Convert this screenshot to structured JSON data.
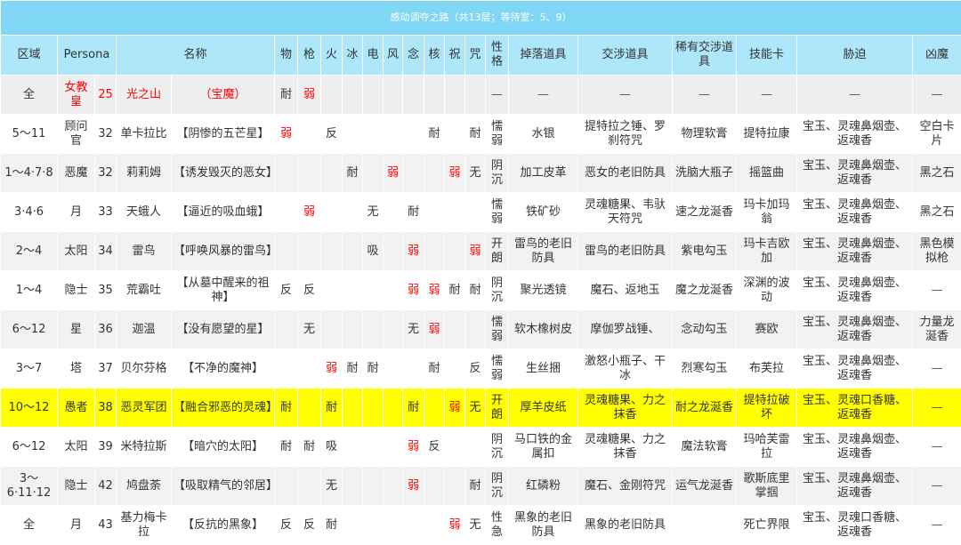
{
  "table": {
    "title": "感动调夺之路（共13层；等待室：5、9）",
    "headers": [
      "区域",
      "Persona",
      "名称",
      "物",
      "枪",
      "火",
      "冰",
      "电",
      "风",
      "念",
      "核",
      "祝",
      "咒",
      "性格",
      "掉落道具",
      "交涉道具",
      "稀有交涉道具",
      "技能卡",
      "胁迫",
      "凶魔"
    ],
    "rows": [
      [
        "全",
        "女教皇",
        "25",
        "光之山",
        "（宝魔）",
        "耐",
        "弱",
        "",
        "",
        "",
        "",
        "",
        "",
        "",
        "",
        "—",
        "—",
        "—",
        "—",
        "—",
        "—",
        "—"
      ],
      [
        "5～11",
        "顾问官",
        "32",
        "单卡拉比",
        "【阴惨的五芒星】",
        "弱",
        "",
        "反",
        "",
        "",
        "",
        "",
        "耐",
        "",
        "耐",
        "懦弱",
        "水银",
        "提特拉之锤、罗刹符咒",
        "物理软膏",
        "提特拉康",
        "宝玉、灵魂鼻烟壶、返魂香",
        "空白卡片"
      ],
      [
        "1～4·7·8",
        "恶魔",
        "32",
        "莉莉姆",
        "【诱发毁灭的恶女】",
        "",
        "",
        "",
        "耐",
        "",
        "弱",
        "",
        "",
        "弱",
        "无",
        "阴沉",
        "加工皮革",
        "恶女的老旧防具",
        "洗脑大瓶子",
        "摇篮曲",
        "宝玉、灵魂鼻烟壶、返魂香",
        "黑之石"
      ],
      [
        "3·4·6",
        "月",
        "33",
        "天蛾人",
        "【逼近的吸血蛾】",
        "",
        "弱",
        "",
        "",
        "无",
        "",
        "耐",
        "",
        "",
        "",
        "懦弱",
        "铁矿砂",
        "灵魂糖果、韦驮天符咒",
        "速之龙涎香",
        "玛卡加玛翁",
        "宝玉、灵魂鼻烟壶、返魂香",
        "黑之石"
      ],
      [
        "2～4",
        "太阳",
        "34",
        "雷鸟",
        "【呼唤风暴的雷鸟】",
        "",
        "",
        "",
        "",
        "吸",
        "",
        "弱",
        "",
        "",
        "弱",
        "开朗",
        "雷鸟的老旧防具",
        "雷鸟的老旧防具",
        "紫电勾玉",
        "玛卡吉欧加",
        "宝玉、灵魂鼻烟壶、返魂香",
        "黑色模拟枪"
      ],
      [
        "1～4",
        "隐士",
        "35",
        "荒霸吐",
        "【从墓中醒来的祖神】",
        "反",
        "反",
        "",
        "",
        "",
        "",
        "弱",
        "弱",
        "耐",
        "耐",
        "阴沉",
        "聚光透镜",
        "魔石、返地玉",
        "魔之龙涎香",
        "深渊的波动",
        "宝玉、灵魂鼻烟壶、返魂香",
        "—"
      ],
      [
        "6～12",
        "星",
        "36",
        "迦温",
        "【没有愿望的星】",
        "",
        "无",
        "",
        "",
        "",
        "",
        "无",
        "弱",
        "",
        "",
        "懦弱",
        "软木橡树皮",
        "摩伽罗战锤、",
        "念动勾玉",
        "赛欧",
        "宝玉、灵魂鼻烟壶、返魂香",
        "力量龙涎香"
      ],
      [
        "3～7",
        "塔",
        "37",
        "贝尔芬格",
        "【不净的魔神】",
        "",
        "",
        "弱",
        "耐",
        "耐",
        "",
        "",
        "耐",
        "",
        "反",
        "懦弱",
        "生丝捆",
        "激怒小瓶子、干冰",
        "烈寒勾玉",
        "布芙拉",
        "宝玉、灵魂鼻烟壶、返魂香",
        "—"
      ],
      [
        "10～12",
        "愚者",
        "38",
        "恶灵军团",
        "【融合邪恶的灵魂】",
        "耐",
        "",
        "耐",
        "",
        "",
        "",
        "耐",
        "",
        "弱",
        "无",
        "开朗",
        "厚羊皮纸",
        "灵魂糖果、力之抹香",
        "耐之龙涎香",
        "提特拉破坏",
        "宝玉、灵魂口香糖、返魂香",
        "—"
      ],
      [
        "6～12",
        "太阳",
        "39",
        "米特拉斯",
        "【暗穴的太阳】",
        "耐",
        "耐",
        "吸",
        "",
        "",
        "",
        "弱",
        "反",
        "",
        "",
        "阴沉",
        "马口铁的金属扣",
        "灵魂糖果、力之抹香",
        "魔法软膏",
        "玛哈芙雷拉",
        "宝玉、灵魂鼻烟壶、返魂香",
        "—"
      ],
      [
        "3～6·11·12",
        "隐士",
        "42",
        "鸠盘荼",
        "【吸取精气的邻居】",
        "",
        "",
        "无",
        "",
        "",
        "",
        "弱",
        "",
        "",
        "耐",
        "阴沉",
        "红磷粉",
        "魔石、金刚符咒",
        "运气龙涎香",
        "歌斯底里掌掴",
        "宝玉、灵魂鼻烟壶、返魂香",
        "—"
      ],
      [
        "全",
        "月",
        "43",
        "基力梅卡拉",
        "【反抗的黑象】",
        "反",
        "反",
        "耐",
        "",
        "",
        "",
        "",
        "",
        "弱",
        "无",
        "性急",
        "黑象的老旧防具",
        "黑象的老旧防具",
        "",
        "死亡界限",
        "宝玉、灵魂口香糖、返魂香",
        "—"
      ]
    ]
  },
  "colors": {
    "title_bg": "#7fd6f5",
    "header_bg": "#aee6fa",
    "highlight_bg": "#ffff00",
    "weak_text": "#ff0000"
  }
}
